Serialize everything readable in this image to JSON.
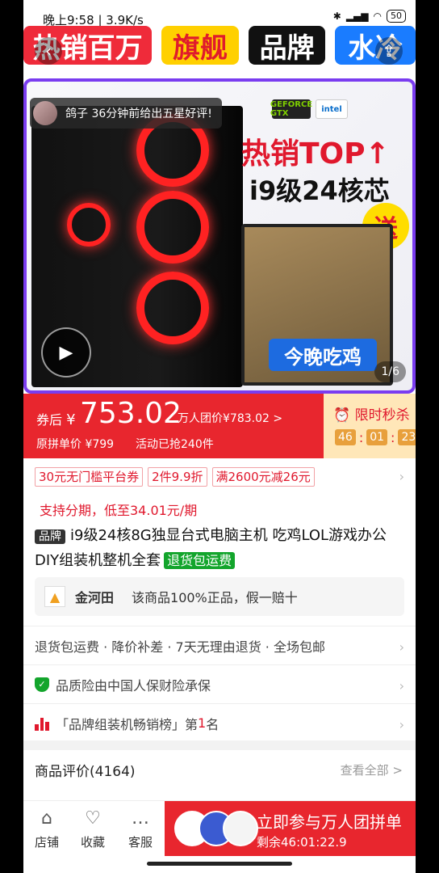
{
  "status": {
    "time": "晚上9:58 | 3.9K/s",
    "battery": "50"
  },
  "banner": [
    "热销百万",
    "旗舰",
    "品牌",
    "水冷"
  ],
  "hero": {
    "review_text": "鸽子 36分钟前给出五星好评!",
    "headline": "热销TOP↑",
    "subline": "i9级24核芯",
    "gift": "送",
    "tonight": "今晚吃鸡",
    "pager": "1/6",
    "logo_gtx": "GEFORCE GTX",
    "logo_intel": "intel"
  },
  "price": {
    "after_label": "券后",
    "currency": "¥",
    "value": "753.02",
    "group_price": "万人团价¥783.02 >",
    "orig_price": "原拼单价 ¥799",
    "sold": "活动已抢240件",
    "flash_label": "限时秒杀",
    "timer": [
      "46",
      "01",
      "23"
    ]
  },
  "coupons": [
    "30元无门槛平台券",
    "2件9.9折",
    "满2600元减26元"
  ],
  "installment": "支持分期，低至34.01元/期",
  "product": {
    "brand_tag": "品牌",
    "title": "i9级24核8G独显台式电脑主机 吃鸡LOL游戏办公DIY组装机整机全套",
    "return_tag": "退货包运费"
  },
  "seller": {
    "name": "金河田",
    "desc": "该商品100%正品，假一赔十"
  },
  "services": "退货包运费 · 降价补差 · 7天无理由退货 · 全场包邮",
  "insurance": "品质险由中国人保财险承保",
  "rank": {
    "prefix": "「品牌组装机畅销榜」第",
    "num": "1",
    "suffix": "名"
  },
  "reviews": {
    "title": "商品评价(4164)",
    "see_all": "查看全部 >"
  },
  "bottom": {
    "store": "店铺",
    "fav": "收藏",
    "service": "客服",
    "cta_main": "立即参与万人团拼单",
    "cta_sub": "剩余46:01:22.9"
  },
  "colors": {
    "accent": "#e8262e",
    "green": "#13a52c",
    "flash_bg": "#ffe7b8"
  }
}
